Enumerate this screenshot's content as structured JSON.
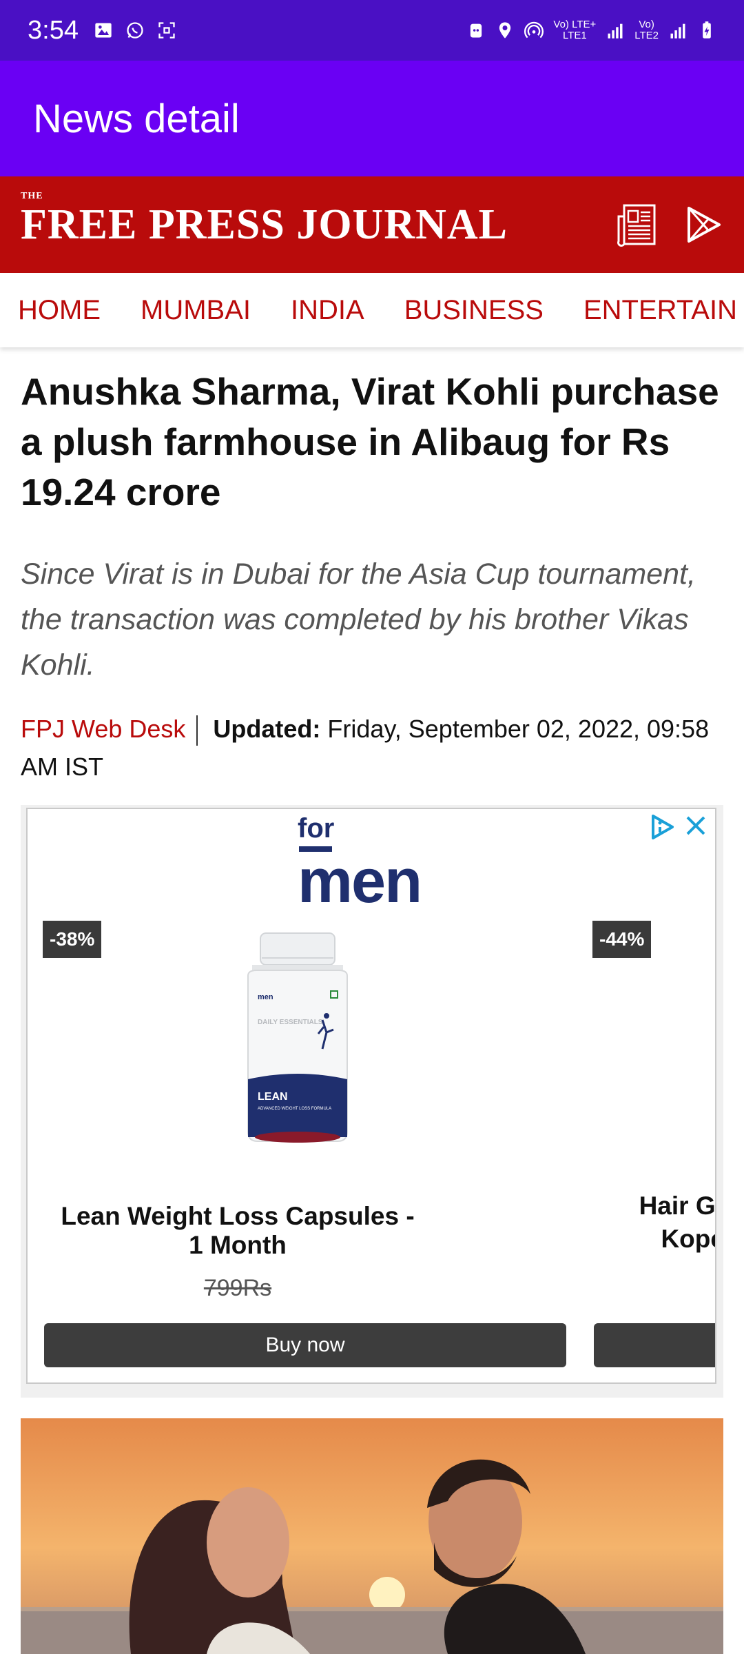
{
  "status_bar": {
    "time": "3:54",
    "lte1": "Vo) LTE+",
    "lte1_sub": "LTE1",
    "lte2": "Vo)",
    "lte2_sub": "LTE2"
  },
  "app_bar": {
    "title": "News detail"
  },
  "brand": {
    "the": "THE",
    "name": "FREE PRESS JOURNAL"
  },
  "nav": {
    "items": [
      "HOME",
      "MUMBAI",
      "INDIA",
      "BUSINESS",
      "ENTERTAIN"
    ]
  },
  "article": {
    "headline": "Anushka Sharma, Virat Kohli purchase a plush farmhouse in Alibaug for Rs 19.24 crore",
    "summary": "Since Virat is in Dubai for the Asia Cup tournament, the transaction was completed by his brother Vikas Kohli.",
    "author": "FPJ Web Desk",
    "updated_label": "Updated:",
    "updated_value": "Friday, September 02, 2022, 09:58 AM IST"
  },
  "ad": {
    "logo_for": "for",
    "logo_men": "men",
    "product1": {
      "discount": "-38%",
      "name": "Lean Weight Loss Capsules - 1 Month",
      "price": "799Rs",
      "button": "Buy now",
      "bottle_brand": "men",
      "bottle_line": "DAILY ESSENTIALS",
      "bottle_title": "LEAN",
      "bottle_sub": "ADVANCED WEIGHT LOSS FORMULA"
    },
    "product2": {
      "discount": "-44%",
      "name": "Hair Grow Kopex"
    }
  },
  "colors": {
    "status_bar": "#4a10c4",
    "app_bar": "#6a00f4",
    "brand_red": "#b90b0b",
    "ad_navy": "#1f2f6e"
  },
  "icons": {
    "gallery": "gallery-icon",
    "whatsapp": "whatsapp-icon",
    "screenshot": "screenshot-icon",
    "epaper": "newspaper-icon",
    "play": "play-store-icon"
  }
}
